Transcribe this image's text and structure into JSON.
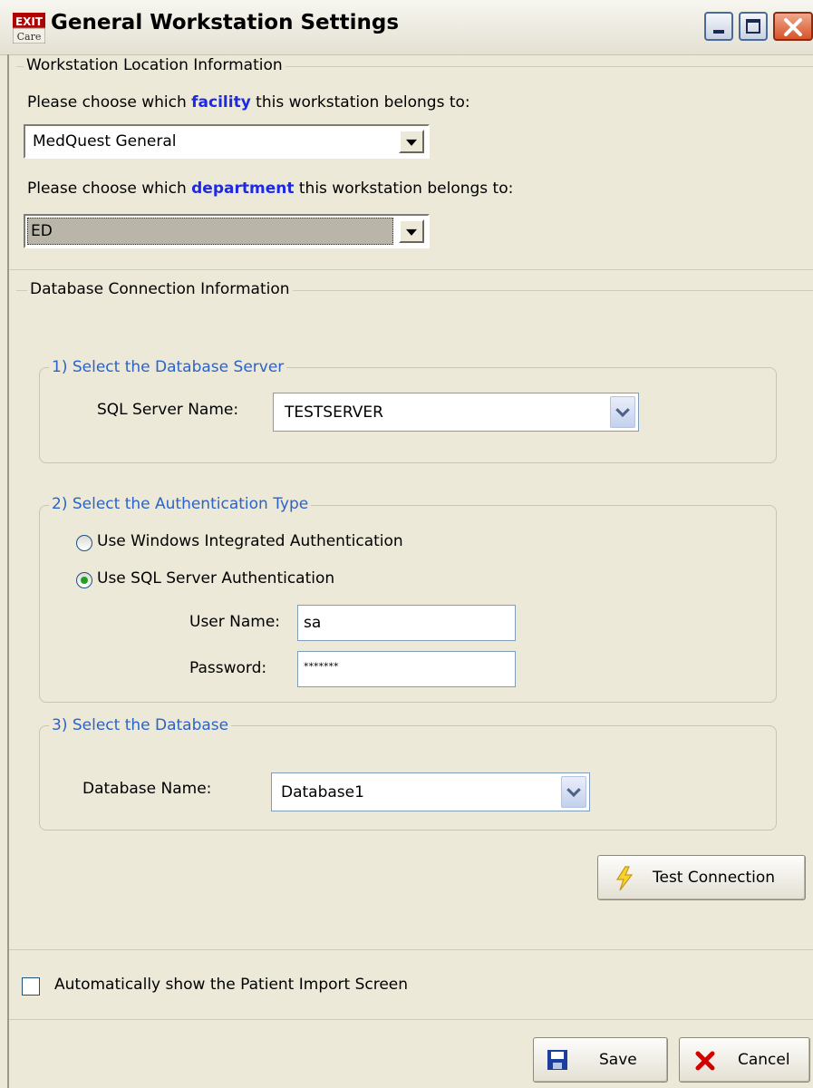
{
  "window": {
    "title": "General Workstation Settings",
    "app_icon_text_top": "EXIT",
    "app_icon_text_bottom": "Care"
  },
  "location": {
    "legend": "Workstation Location Information",
    "facility_prompt_before": "Please choose which ",
    "facility_prompt_keyword": "facility",
    "facility_prompt_after": " this workstation belongs to:",
    "facility_value": "MedQuest General",
    "department_prompt_before": "Please choose which ",
    "department_prompt_keyword": "department",
    "department_prompt_after": " this workstation belongs to:",
    "department_value": "ED"
  },
  "database": {
    "legend": "Database Connection Information",
    "server_group_legend": "1) Select the Database Server",
    "server_label": "SQL Server Name:",
    "server_value": "TESTSERVER",
    "auth_group_legend": "2) Select the Authentication Type",
    "auth_windows_label": "Use Windows Integrated Authentication",
    "auth_sql_label": "Use SQL Server Authentication",
    "auth_selected": "sql",
    "username_label": "User Name:",
    "username_value": "sa",
    "password_label": "Password:",
    "password_value": "*******",
    "db_group_legend": "3) Select the Database",
    "db_label": "Database Name:",
    "db_value": "Database1",
    "test_button_label": "Test Connection"
  },
  "options": {
    "auto_import_label": "Automatically show the Patient Import Screen",
    "auto_import_checked": false
  },
  "footer": {
    "save_label": "Save",
    "cancel_label": "Cancel"
  },
  "colors": {
    "background": "#ece9d8",
    "keyword_blue": "#1e29e0",
    "legend_blue": "#2b63c8",
    "radio_dot": "#21a121",
    "cancel_x": "#d40000"
  }
}
